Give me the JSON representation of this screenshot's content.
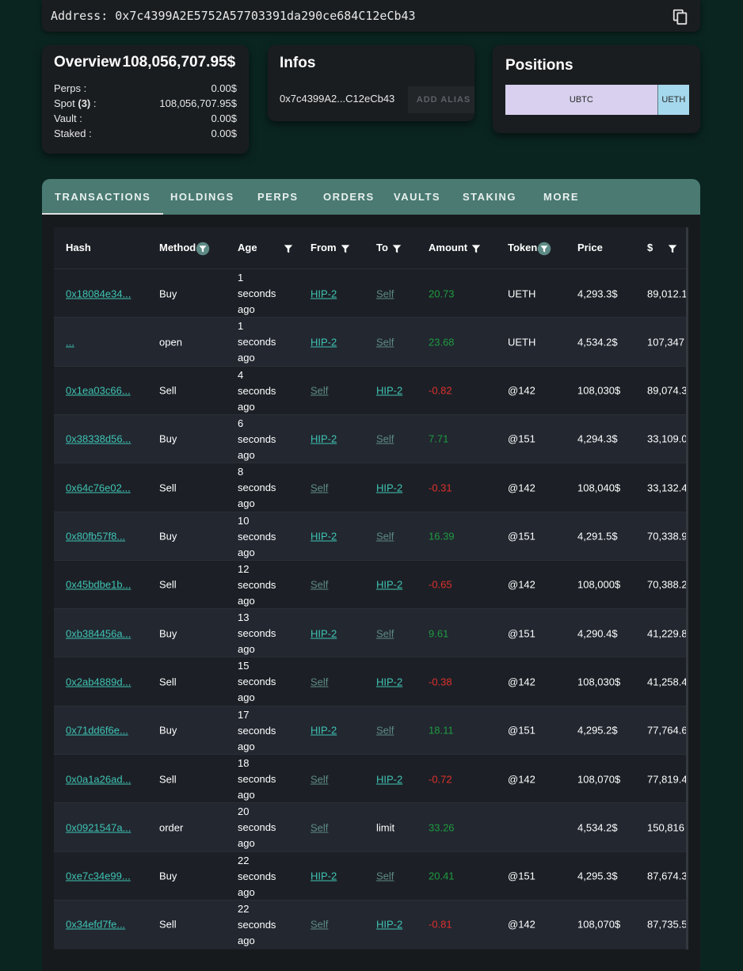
{
  "address": {
    "label": "Address:",
    "value": "0x7c4399A2E5752A57703391da290ce684C12eCb43"
  },
  "overview": {
    "title": "Overview",
    "total": "108,056,707.95$",
    "rows": [
      {
        "label": "Perps :",
        "value": "0.00$"
      },
      {
        "label_prefix": "Spot ",
        "label_count": "(3)",
        "label_suffix": " :",
        "value": "108,056,707.95$"
      },
      {
        "label": "Vault :",
        "value": "0.00$"
      },
      {
        "label": "Staked :",
        "value": "0.00$"
      }
    ]
  },
  "infos": {
    "title": "Infos",
    "address_short": "0x7c4399A2...C12eCb43",
    "alias_button": "ADD ALIAS"
  },
  "positions": {
    "title": "Positions",
    "segments": [
      {
        "label": "UBTC",
        "share": 0.83,
        "color": "#d8d0ee"
      },
      {
        "label": "UETH",
        "share": 0.17,
        "color": "#a5d8ec"
      }
    ]
  },
  "tabs": [
    "TRANSACTIONS",
    "HOLDINGS",
    "PERPS",
    "ORDERS",
    "VAULTS",
    "STAKING",
    "MORE"
  ],
  "table": {
    "headers": [
      "Hash",
      "Method",
      "Age",
      "From",
      "To",
      "Amount",
      "Token",
      "Price",
      "$"
    ],
    "rows": [
      {
        "hash": "0x18084e34...",
        "method": "Buy",
        "age": [
          "1",
          "seconds",
          "ago"
        ],
        "from": "HIP-2",
        "to": "Self",
        "amount": "20.73",
        "token": "UETH",
        "price": "4,293.3$",
        "usd": "89,012.1"
      },
      {
        "hash": "...",
        "method": "open",
        "age": [
          "1",
          "seconds",
          "ago"
        ],
        "from": "HIP-2",
        "to": "Self",
        "amount": "23.68",
        "token": "UETH",
        "price": "4,534.2$",
        "usd": "107,347"
      },
      {
        "hash": "0x1ea03c66...",
        "method": "Sell",
        "age": [
          "4",
          "seconds",
          "ago"
        ],
        "from": "Self",
        "to": "HIP-2",
        "amount": "-0.82",
        "token": "@142",
        "price": "108,030$",
        "usd": "89,074.3"
      },
      {
        "hash": "0x38338d56...",
        "method": "Buy",
        "age": [
          "6",
          "seconds",
          "ago"
        ],
        "from": "HIP-2",
        "to": "Self",
        "amount": "7.71",
        "token": "@151",
        "price": "4,294.3$",
        "usd": "33,109.0"
      },
      {
        "hash": "0x64c76e02...",
        "method": "Sell",
        "age": [
          "8",
          "seconds",
          "ago"
        ],
        "from": "Self",
        "to": "HIP-2",
        "amount": "-0.31",
        "token": "@142",
        "price": "108,040$",
        "usd": "33,132.4"
      },
      {
        "hash": "0x80fb57f8...",
        "method": "Buy",
        "age": [
          "10",
          "seconds",
          "ago"
        ],
        "from": "HIP-2",
        "to": "Self",
        "amount": "16.39",
        "token": "@151",
        "price": "4,291.5$",
        "usd": "70,338.9"
      },
      {
        "hash": "0x45bdbe1b...",
        "method": "Sell",
        "age": [
          "12",
          "seconds",
          "ago"
        ],
        "from": "Self",
        "to": "HIP-2",
        "amount": "-0.65",
        "token": "@142",
        "price": "108,000$",
        "usd": "70,388.2"
      },
      {
        "hash": "0xb384456a...",
        "method": "Buy",
        "age": [
          "13",
          "seconds",
          "ago"
        ],
        "from": "HIP-2",
        "to": "Self",
        "amount": "9.61",
        "token": "@151",
        "price": "4,290.4$",
        "usd": "41,229.8"
      },
      {
        "hash": "0x2ab4889d...",
        "method": "Sell",
        "age": [
          "15",
          "seconds",
          "ago"
        ],
        "from": "Self",
        "to": "HIP-2",
        "amount": "-0.38",
        "token": "@142",
        "price": "108,030$",
        "usd": "41,258.4"
      },
      {
        "hash": "0x71dd6f6e...",
        "method": "Buy",
        "age": [
          "17",
          "seconds",
          "ago"
        ],
        "from": "HIP-2",
        "to": "Self",
        "amount": "18.11",
        "token": "@151",
        "price": "4,295.2$",
        "usd": "77,764.6"
      },
      {
        "hash": "0x0a1a26ad...",
        "method": "Sell",
        "age": [
          "18",
          "seconds",
          "ago"
        ],
        "from": "Self",
        "to": "HIP-2",
        "amount": "-0.72",
        "token": "@142",
        "price": "108,070$",
        "usd": "77,819.4"
      },
      {
        "hash": "0x0921547a...",
        "method": "order",
        "age": [
          "20",
          "seconds",
          "ago"
        ],
        "from": "Self",
        "to": "limit",
        "amount": "33.26",
        "token": "",
        "price": "4,534.2$",
        "usd": "150,816"
      },
      {
        "hash": "0xe7c34e99...",
        "method": "Buy",
        "age": [
          "22",
          "seconds",
          "ago"
        ],
        "from": "HIP-2",
        "to": "Self",
        "amount": "20.41",
        "token": "@151",
        "price": "4,295.3$",
        "usd": "87,674.3"
      },
      {
        "hash": "0x34efd7fe...",
        "method": "Sell",
        "age": [
          "22",
          "seconds",
          "ago"
        ],
        "from": "Self",
        "to": "HIP-2",
        "amount": "-0.81",
        "token": "@142",
        "price": "108,070$",
        "usd": "87,735.5"
      }
    ]
  },
  "colors": {
    "background": "#0a2520",
    "card": "#1a1d20",
    "tab_bar": "#4a7a72",
    "link": "#3fc3b3",
    "positive": "#1f9a40",
    "negative": "#e0302c"
  },
  "icons": {
    "copy": "copy-icon",
    "filter": "filter-icon"
  }
}
